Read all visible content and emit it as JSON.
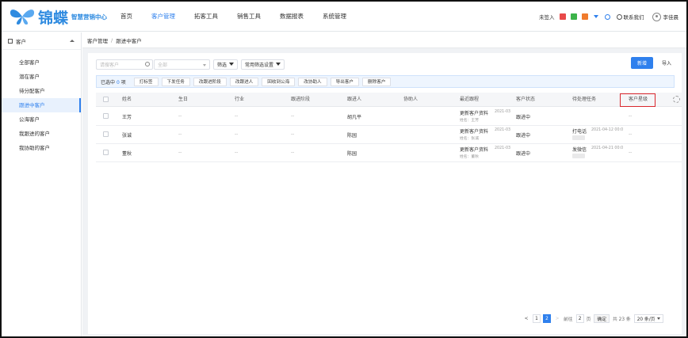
{
  "brand": {
    "logo_text": "锦蝶",
    "subtitle": "智慧营销中心",
    "brand_color": "#2f80ed"
  },
  "nav": [
    {
      "label": "首页",
      "active": false
    },
    {
      "label": "客户管理",
      "active": true
    },
    {
      "label": "拓客工具",
      "active": false
    },
    {
      "label": "销售工具",
      "active": false
    },
    {
      "label": "数据报表",
      "active": false
    },
    {
      "label": "系统管理",
      "active": false
    }
  ],
  "topright": {
    "signin": "未签入",
    "contact": "联系我们",
    "username": "李佳晨"
  },
  "sidebar": {
    "header": "客户",
    "items": [
      "全部客户",
      "潜在客户",
      "待分配客户",
      "跟进中客户",
      "公海客户",
      "我跟进的客户",
      "我协助的客户"
    ],
    "active_index": 3
  },
  "breadcrumb": {
    "root": "客户管理",
    "separator": "/",
    "current": "跟进中客户"
  },
  "filters": {
    "search_placeholder": "请搜客户",
    "select_value": "全部",
    "filter_label": "筛选",
    "common_filter_label": "常用筛选设置"
  },
  "actions": {
    "new_label": "新增",
    "import_label": "导入"
  },
  "batch": {
    "selected_prefix": "已选中",
    "selected_count": "0",
    "selected_suffix": "项",
    "buttons": [
      "打标签",
      "下发任务",
      "改跟进阶段",
      "改跟进人",
      "回收到公海",
      "改协助人",
      "导出客户",
      "删除客户"
    ]
  },
  "table": {
    "columns": [
      "姓名",
      "生日",
      "行业",
      "跟进阶段",
      "跟进人",
      "协助人",
      "最近跟程",
      "客户状态",
      "待处理任务",
      "客户星级"
    ],
    "rows": [
      {
        "name": "王芳",
        "birthday": "--",
        "industry": "--",
        "stage": "--",
        "owner": "胡凡平",
        "assist": "",
        "recent": "更新客户资料",
        "recent_date": "2021-03",
        "recent_sub": "姓名：王芳",
        "status": "跟进中",
        "task": "",
        "task_date": "",
        "stars": "--"
      },
      {
        "name": "张诚",
        "birthday": "--",
        "industry": "--",
        "stage": "--",
        "owner": "陈园",
        "assist": "",
        "recent": "更新客户资料",
        "recent_date": "2021-03",
        "recent_sub": "姓名：张诚",
        "status": "跟进中",
        "task": "打电话",
        "task_date": "2021-04-12 00:0",
        "stars": "--"
      },
      {
        "name": "董秋",
        "birthday": "--",
        "industry": "--",
        "stage": "--",
        "owner": "陈园",
        "assist": "",
        "recent": "更新客户资料",
        "recent_date": "2021-03",
        "recent_sub": "姓名：董秋",
        "status": "跟进中",
        "task": "发微信",
        "task_date": "2021-04-21 00:0",
        "stars": "--"
      }
    ]
  },
  "pagination": {
    "prev": "<",
    "pages": [
      "1",
      "2"
    ],
    "current": "2",
    "next": ">",
    "goto_label": "前往",
    "goto_value": "2",
    "page_unit": "页",
    "confirm": "确定",
    "total": "共 23 条",
    "page_size": "20 条/页"
  }
}
